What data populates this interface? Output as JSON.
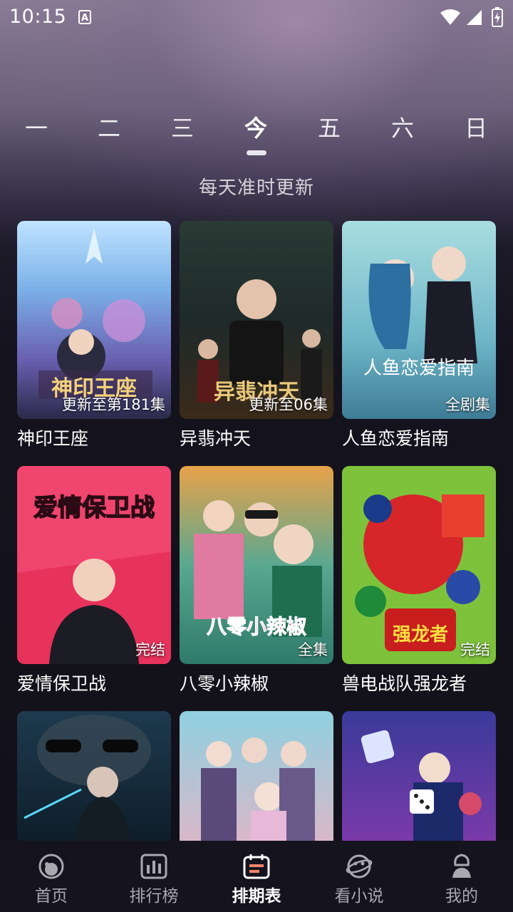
{
  "status_bar": {
    "time": "10:15",
    "notification_icon": "A"
  },
  "weekdays": [
    {
      "label": "一",
      "active": false
    },
    {
      "label": "二",
      "active": false
    },
    {
      "label": "三",
      "active": false
    },
    {
      "label": "今",
      "active": true
    },
    {
      "label": "五",
      "active": false
    },
    {
      "label": "六",
      "active": false
    },
    {
      "label": "日",
      "active": false
    }
  ],
  "subtitle": "每天准时更新",
  "shows": [
    {
      "title": "神印王座",
      "badge": "更新至第181集",
      "poster_text": "神印王座"
    },
    {
      "title": "异翡冲天",
      "badge": "更新至06集",
      "poster_text": "异翡冲天"
    },
    {
      "title": "人鱼恋爱指南",
      "badge": "全剧集",
      "poster_text": "人鱼恋爱指南"
    },
    {
      "title": "爱情保卫战",
      "badge": "完结",
      "poster_text": "爱情保卫战"
    },
    {
      "title": "八零小辣椒",
      "badge": "全集",
      "poster_text": "八零小辣椒"
    },
    {
      "title": "兽电战队强龙者",
      "badge": "完结",
      "poster_text": "强龙者"
    },
    {
      "title": "",
      "badge": "",
      "poster_text": ""
    },
    {
      "title": "",
      "badge": "",
      "poster_text": ""
    },
    {
      "title": "",
      "badge": "",
      "poster_text": ""
    }
  ],
  "bottom_nav": [
    {
      "label": "首页",
      "icon": "home-icon",
      "active": false
    },
    {
      "label": "排行榜",
      "icon": "ranking-icon",
      "active": false
    },
    {
      "label": "排期表",
      "icon": "schedule-icon",
      "active": true
    },
    {
      "label": "看小说",
      "icon": "novel-icon",
      "active": false
    },
    {
      "label": "我的",
      "icon": "profile-icon",
      "active": false
    }
  ],
  "colors": {
    "accent_active": "#ffffff",
    "nav_inactive": "#a9a7b0",
    "background": "#14121c",
    "schedule_icon_accent": "#f0866a"
  }
}
